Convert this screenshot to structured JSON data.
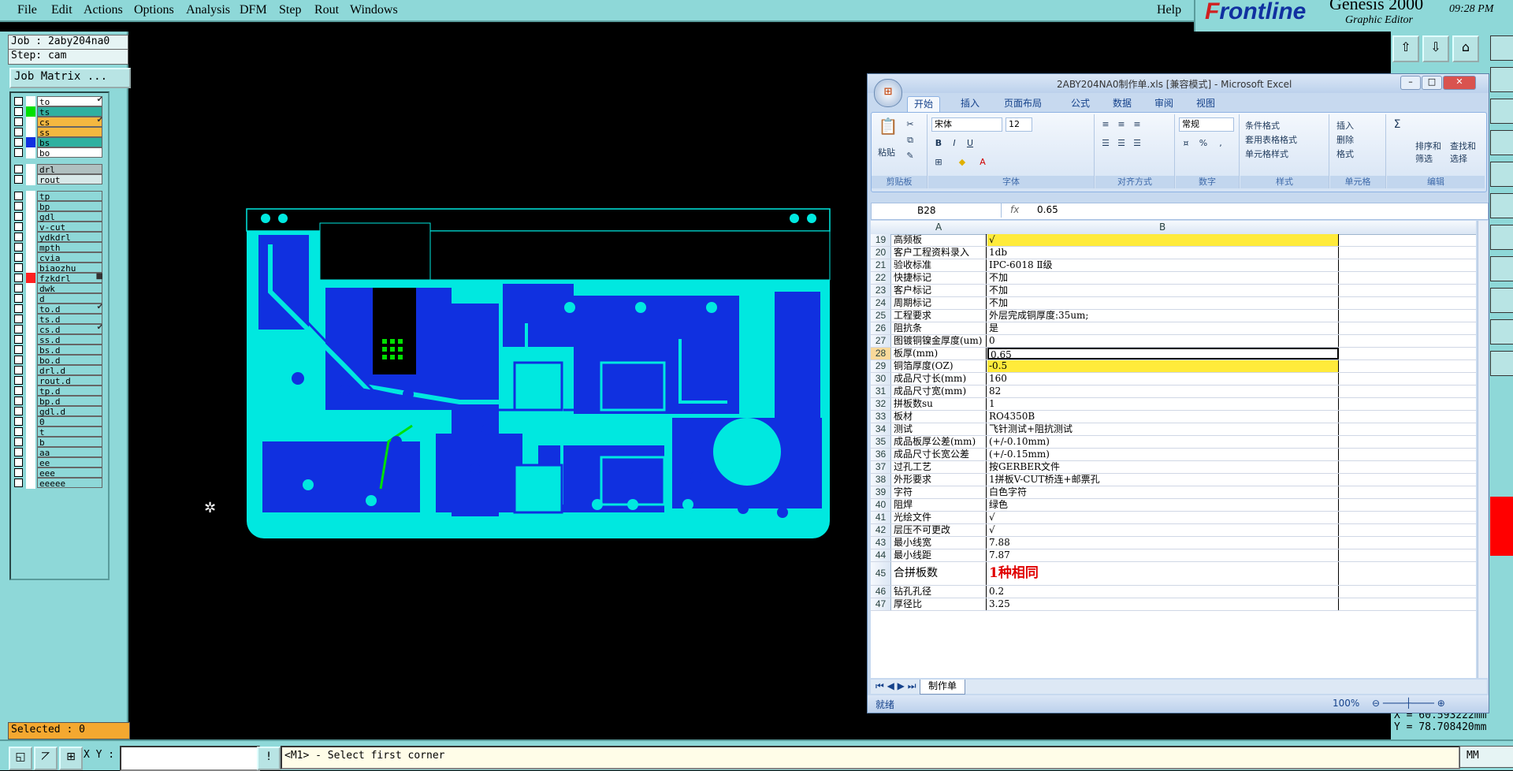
{
  "menubar": {
    "items": [
      "File",
      "Edit",
      "Actions",
      "Options",
      "Analysis",
      "DFM",
      "Step",
      "Rout",
      "Windows"
    ],
    "help": "Help"
  },
  "brand": {
    "logo_prefix": "F",
    "logo_rest": "rontline",
    "product": "Genesis 2000",
    "subtitle": "Graphic Editor",
    "time": "09:28 PM"
  },
  "job": {
    "job_label": "Job : 2aby204na0",
    "step_label": "Step: cam",
    "matrix_button": "Job Matrix ..."
  },
  "layers": [
    {
      "name": "to",
      "color": "#ffffff",
      "bg": "#ffffff",
      "mark": "✔"
    },
    {
      "name": "ts",
      "color": "#00e000",
      "bg": "#30b0a0",
      "mark": ""
    },
    {
      "name": "cs",
      "color": "#ffffff",
      "bg": "#f4b840",
      "mark": "✔"
    },
    {
      "name": "ss",
      "color": "#ffffff",
      "bg": "#f4b840",
      "mark": ""
    },
    {
      "name": "bs",
      "color": "#1030e0",
      "bg": "#30b0a0",
      "mark": ""
    },
    {
      "name": "bo",
      "color": "#ffffff",
      "bg": "#ffffff",
      "mark": ""
    },
    {
      "name": "drl",
      "color": "#ffffff",
      "bg": "#b0c0c0",
      "mark": ""
    },
    {
      "name": "rout",
      "color": "#ffffff",
      "bg": "#d8e8e8",
      "mark": ""
    },
    {
      "name": "tp",
      "color": "#ffffff",
      "bg": "#8ed8d8",
      "mark": ""
    },
    {
      "name": "bp",
      "color": "#ffffff",
      "bg": "#8ed8d8",
      "mark": ""
    },
    {
      "name": "gdl",
      "color": "#ffffff",
      "bg": "#8ed8d8",
      "mark": ""
    },
    {
      "name": "v-cut",
      "color": "#ffffff",
      "bg": "#8ed8d8",
      "mark": ""
    },
    {
      "name": "ydkdrl",
      "color": "#ffffff",
      "bg": "#8ed8d8",
      "mark": ""
    },
    {
      "name": "mpth",
      "color": "#ffffff",
      "bg": "#8ed8d8",
      "mark": ""
    },
    {
      "name": "cvia",
      "color": "#ffffff",
      "bg": "#8ed8d8",
      "mark": ""
    },
    {
      "name": "biaozhu",
      "color": "#ffffff",
      "bg": "#8ed8d8",
      "mark": ""
    },
    {
      "name": "fzkdrl",
      "color": "#ff2020",
      "bg": "#8ed8d8",
      "mark": "■"
    },
    {
      "name": "dwk",
      "color": "#ffffff",
      "bg": "#8ed8d8",
      "mark": ""
    },
    {
      "name": "d",
      "color": "#ffffff",
      "bg": "#8ed8d8",
      "mark": ""
    },
    {
      "name": "to.d",
      "color": "#ffffff",
      "bg": "#8ed8d8",
      "mark": "✔"
    },
    {
      "name": "ts.d",
      "color": "#ffffff",
      "bg": "#8ed8d8",
      "mark": ""
    },
    {
      "name": "cs.d",
      "color": "#ffffff",
      "bg": "#8ed8d8",
      "mark": "✔"
    },
    {
      "name": "ss.d",
      "color": "#ffffff",
      "bg": "#8ed8d8",
      "mark": ""
    },
    {
      "name": "bs.d",
      "color": "#ffffff",
      "bg": "#8ed8d8",
      "mark": ""
    },
    {
      "name": "bo.d",
      "color": "#ffffff",
      "bg": "#8ed8d8",
      "mark": ""
    },
    {
      "name": "drl.d",
      "color": "#ffffff",
      "bg": "#8ed8d8",
      "mark": ""
    },
    {
      "name": "rout.d",
      "color": "#ffffff",
      "bg": "#8ed8d8",
      "mark": ""
    },
    {
      "name": "tp.d",
      "color": "#ffffff",
      "bg": "#8ed8d8",
      "mark": ""
    },
    {
      "name": "bp.d",
      "color": "#ffffff",
      "bg": "#8ed8d8",
      "mark": ""
    },
    {
      "name": "gdl.d",
      "color": "#ffffff",
      "bg": "#8ed8d8",
      "mark": ""
    },
    {
      "name": "0",
      "color": "#ffffff",
      "bg": "#8ed8d8",
      "mark": ""
    },
    {
      "name": "t",
      "color": "#ffffff",
      "bg": "#8ed8d8",
      "mark": ""
    },
    {
      "name": "b",
      "color": "#ffffff",
      "bg": "#8ed8d8",
      "mark": ""
    },
    {
      "name": "aa",
      "color": "#ffffff",
      "bg": "#8ed8d8",
      "mark": ""
    },
    {
      "name": "ee",
      "color": "#ffffff",
      "bg": "#8ed8d8",
      "mark": ""
    },
    {
      "name": "eee",
      "color": "#ffffff",
      "bg": "#8ed8d8",
      "mark": ""
    },
    {
      "name": "eeeee",
      "color": "#ffffff",
      "bg": "#8ed8d8",
      "mark": ""
    }
  ],
  "selected": "Selected : 0",
  "coords": {
    "x": "X = 60.593222mm",
    "y": "Y = 78.708420mm"
  },
  "bottom": {
    "xy_label": "X Y :",
    "message": "<M1> - Select first corner",
    "units": "MM"
  },
  "excel": {
    "title": "2ABY204NA0制作单.xls  [兼容模式] - Microsoft Excel",
    "tabs": [
      "开始",
      "插入",
      "页面布局",
      "公式",
      "数据",
      "审阅",
      "视图"
    ],
    "groups": {
      "clipboard": "剪贴板",
      "paste": "粘贴",
      "font": "字体",
      "font_name": "宋体",
      "font_size": "12",
      "align": "对齐方式",
      "number": "数字",
      "number_format": "常规",
      "style": "样式",
      "cond_format": "条件格式",
      "table_format": "套用表格格式",
      "cell_style": "单元格样式",
      "cells": "单元格",
      "insert": "插入",
      "delete": "删除",
      "format": "格式",
      "edit": "编辑",
      "sort": "排序和\n筛选",
      "find": "查找和\n选择"
    },
    "namebox": "B28",
    "formula": "0.65",
    "col_a": "A",
    "col_b": "B",
    "rows": [
      {
        "n": "19",
        "a": "高频板",
        "b": "√",
        "hl": true
      },
      {
        "n": "20",
        "a": "客户工程资料录入",
        "b": "1db"
      },
      {
        "n": "21",
        "a": "验收标准",
        "b": "IPC-6018 Ⅱ级"
      },
      {
        "n": "22",
        "a": "快捷标记",
        "b": "不加"
      },
      {
        "n": "23",
        "a": "客户标记",
        "b": "不加"
      },
      {
        "n": "24",
        "a": "周期标记",
        "b": "不加"
      },
      {
        "n": "25",
        "a": "工程要求",
        "b": "外层完成铜厚度:35um;"
      },
      {
        "n": "26",
        "a": "阻抗条",
        "b": "是"
      },
      {
        "n": "27",
        "a": "图镀铜镍金厚度(um)",
        "b": "0"
      },
      {
        "n": "28",
        "a": "板厚(mm)",
        "b": "0.65",
        "sel": true
      },
      {
        "n": "29",
        "a": "铜箔厚度(OZ)",
        "b": "-0.5",
        "hl": true
      },
      {
        "n": "30",
        "a": "成品尺寸长(mm)",
        "b": "160"
      },
      {
        "n": "31",
        "a": "成品尺寸宽(mm)",
        "b": "82"
      },
      {
        "n": "32",
        "a": "拼板数su",
        "b": "1"
      },
      {
        "n": "33",
        "a": "板材",
        "b": "RO4350B"
      },
      {
        "n": "34",
        "a": "测试",
        "b": "飞针测试+阻抗测试"
      },
      {
        "n": "35",
        "a": "成品板厚公差(mm)",
        "b": "(+/-0.10mm)"
      },
      {
        "n": "36",
        "a": "成品尺寸长宽公差",
        "b": "(+/-0.15mm)"
      },
      {
        "n": "37",
        "a": "过孔工艺",
        "b": "按GERBER文件"
      },
      {
        "n": "38",
        "a": "外形要求",
        "b": "1拼板V-CUT桥连+邮票孔"
      },
      {
        "n": "39",
        "a": "字符",
        "b": "白色字符"
      },
      {
        "n": "40",
        "a": "阻焊",
        "b": "绿色"
      },
      {
        "n": "41",
        "a": "光绘文件",
        "b": "√"
      },
      {
        "n": "42",
        "a": "层压不可更改",
        "b": "√"
      },
      {
        "n": "43",
        "a": "最小线宽",
        "b": "7.88"
      },
      {
        "n": "44",
        "a": "最小线距",
        "b": "7.87"
      },
      {
        "n": "45",
        "a": "合拼板数",
        "b": "1种相同",
        "big": true
      },
      {
        "n": "46",
        "a": "钻孔孔径",
        "b": "0.2"
      },
      {
        "n": "47",
        "a": "厚径比",
        "b": "3.25"
      }
    ],
    "sheet_tab": "制作单",
    "status_ready": "就绪",
    "zoom": "100%"
  }
}
